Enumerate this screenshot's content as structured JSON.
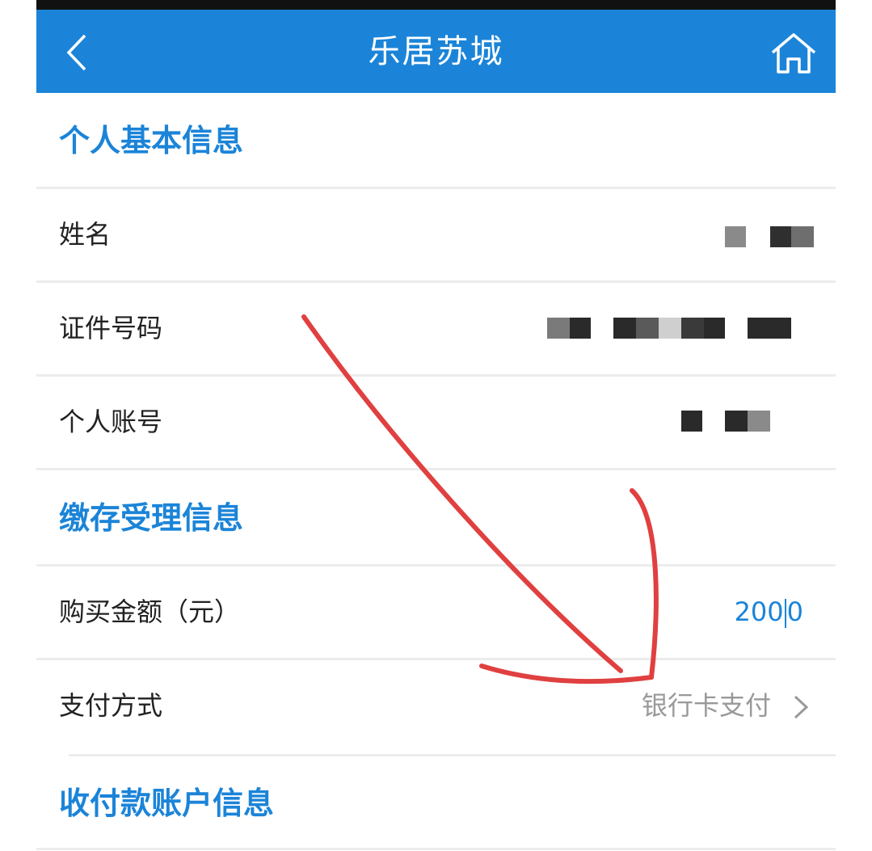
{
  "header": {
    "title": "乐居苏城",
    "back_icon": "chevron-left-icon",
    "home_icon": "home-icon",
    "background": "#1b84d8"
  },
  "sections": {
    "personal": {
      "title": "个人基本信息",
      "name_label": "姓名",
      "id_label": "证件号码",
      "account_label": "个人账号"
    },
    "deposit": {
      "title": "缴存受理信息",
      "amount_label": "购买金额（元）",
      "amount_value_a": "200",
      "amount_value_b": "0",
      "payment_label": "支付方式",
      "payment_value": "银行卡支付"
    },
    "account": {
      "title": "收付款账户信息"
    }
  },
  "colors": {
    "accent": "#1b84d8",
    "annotation": "#e04040"
  }
}
